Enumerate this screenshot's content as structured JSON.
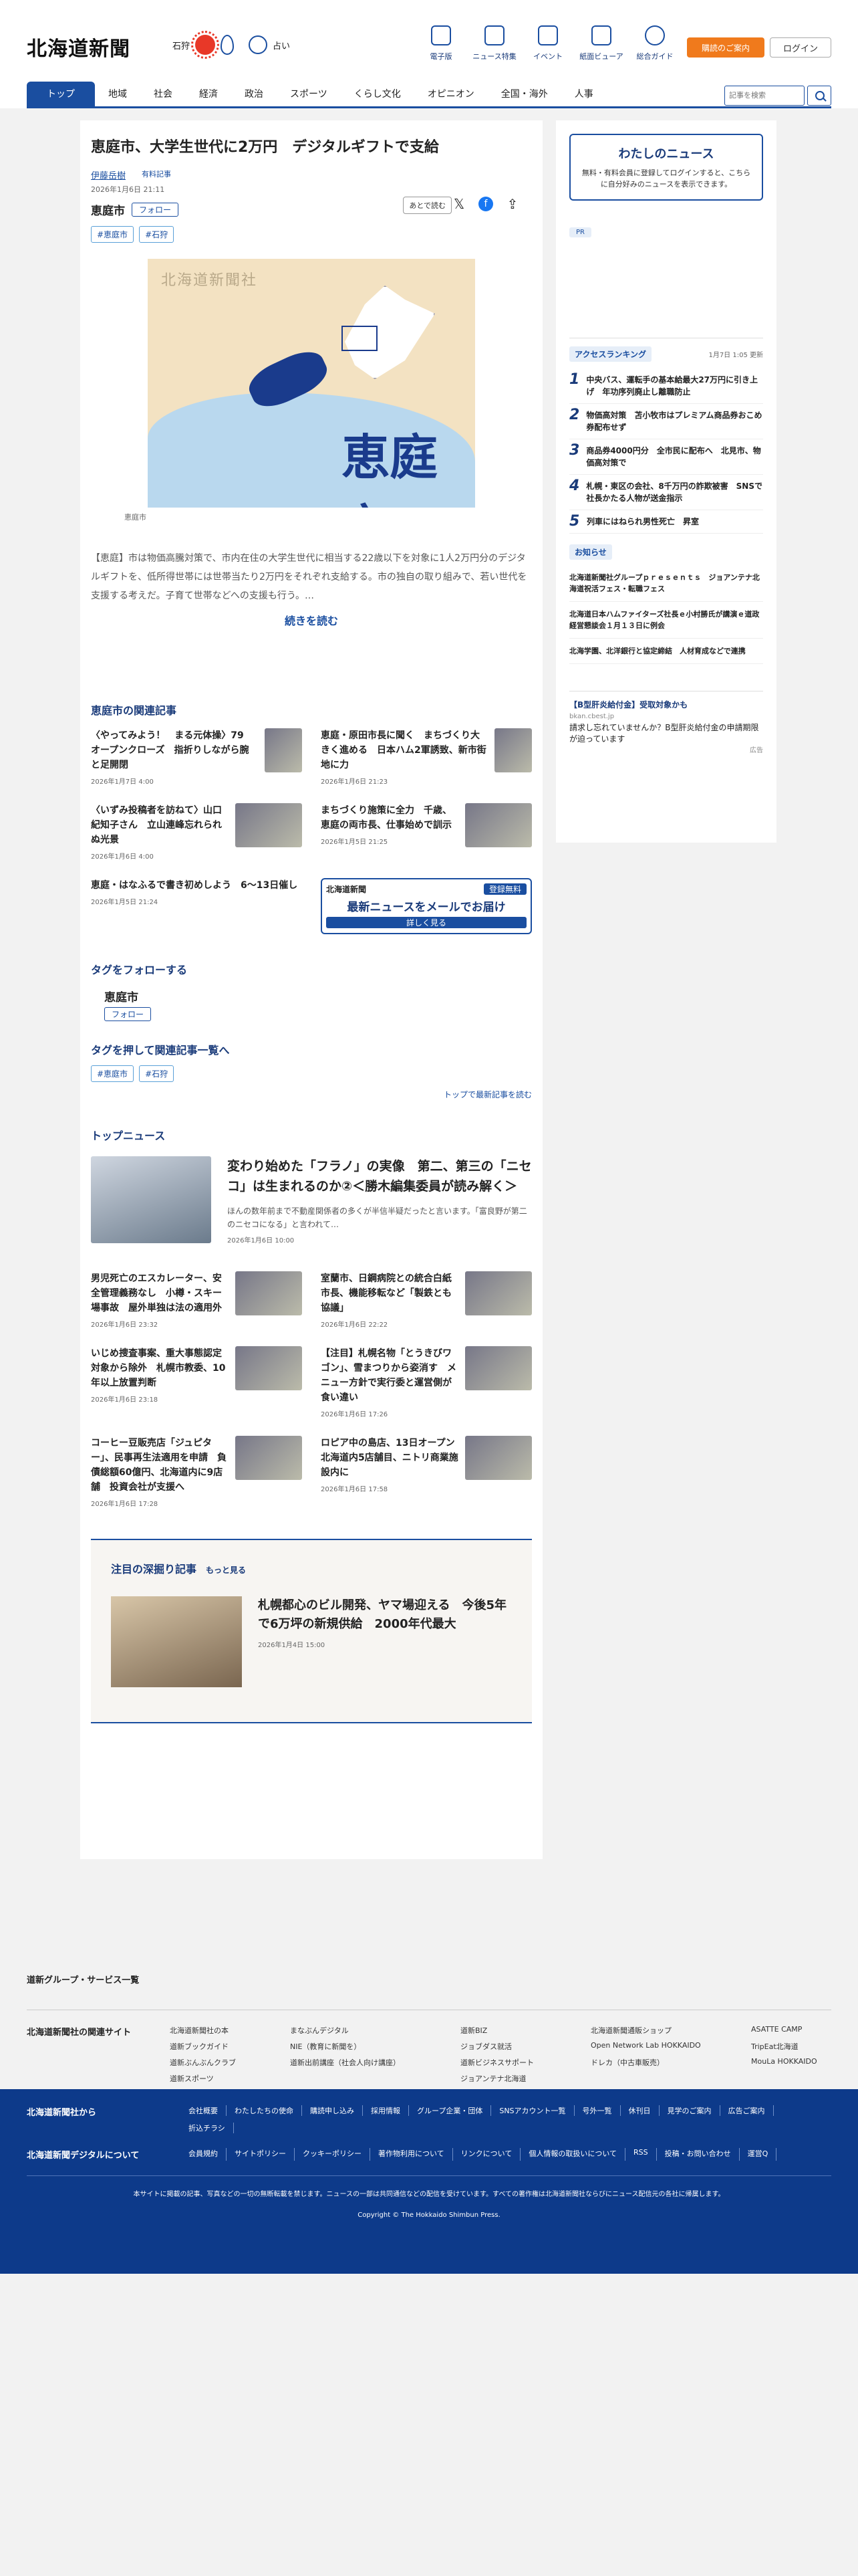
{
  "header": {
    "logo": "北海道新聞",
    "location": "石狩",
    "fortune_label": "占い",
    "nav": [
      "電子版",
      "ニュース特集",
      "イベント",
      "紙面ビューア",
      "総合ガイド"
    ],
    "subscribe": "購読のご案内",
    "login": "ログイン"
  },
  "mainnav": {
    "items": [
      "トップ",
      "地域",
      "社会",
      "経済",
      "政治",
      "スポーツ",
      "くらし文化",
      "オピニオン",
      "全国・海外",
      "人事"
    ],
    "search_placeholder": "記事を検索"
  },
  "article": {
    "title": "恵庭市、大学生世代に2万円　デジタルギフトで支給",
    "author": "伊藤岳樹",
    "subscriber_label": "有料記事",
    "date": "2026年1月6日 21:11",
    "later_button": "あとで読む",
    "category": "恵庭市",
    "follow": "フォロー",
    "tags": [
      "#恵庭市",
      "#石狩"
    ],
    "map_watermark": "北海道新聞社",
    "map_city": "恵庭市",
    "caption": "恵庭市",
    "lead": "【恵庭】市は物価高騰対策で、市内在住の大学生世代に相当する22歳以下を対象に1人2万円分のデジタルギフトを、低所得世帯には世帯当たり2万円をそれぞれ支給する。市の独自の取り組みで、若い世代を支援する考えだ。子育て世帯などへの支援も行う。…",
    "read_more": "続きを読む"
  },
  "related": {
    "heading": "恵庭市の関連記事",
    "items": [
      {
        "title": "〈やってみよう！　まる元体操〉79　オープンクローズ　指折りしながら腕と足開閉",
        "date": "2026年1月7日 4:00"
      },
      {
        "title": "恵庭・原田市長に聞く　まちづくり大きく進める　日本ハム2軍誘致、新市街地に力",
        "date": "2026年1月6日 21:23"
      },
      {
        "title": "〈いずみ投稿者を訪ねて〉山口紀知子さん　立山連峰忘れられぬ光景",
        "date": "2026年1月6日 4:00"
      },
      {
        "title": "まちづくり施策に全力　千歳、恵庭の両市長、仕事始めで訓示",
        "date": "2026年1月5日 21:25"
      },
      {
        "title": "恵庭・はなふるで書き初めしよう　6～13日催し",
        "date": "2026年1月5日 21:24"
      }
    ],
    "ad": {
      "brand": "北海道新聞",
      "free": "登録無料",
      "headline": "最新ニュースをメールでお届け",
      "detail": "詳しく見る"
    }
  },
  "tagfollow": {
    "heading": "タグをフォローする",
    "name": "恵庭市",
    "follow": "フォロー"
  },
  "taglist": {
    "heading": "タグを押して関連記事一覧へ",
    "tags": [
      "#恵庭市",
      "#石狩"
    ],
    "latest": "トップで最新記事を読む"
  },
  "topnews": {
    "heading": "トップニュース",
    "feature": {
      "title": "変わり始めた「フラノ」の実像　第二、第三の「ニセコ」は生まれるのか②＜勝木編集委員が読み解く＞",
      "desc": "ほんの数年前まで不動産関係者の多くが半信半疑だったと言います。「富良野が第二のニセコになる」と言われて…",
      "date": "2026年1月6日 10:00"
    },
    "items": [
      {
        "title": "男児死亡のエスカレーター、安全管理義務なし　小樽・スキー場事故　屋外単独は法の適用外",
        "date": "2026年1月6日 23:32"
      },
      {
        "title": "室蘭市、日鋼病院との統合白紙　市長、機能移転など「製鉄とも協議」",
        "date": "2026年1月6日 22:22"
      },
      {
        "title": "いじめ捜査事案、重大事態認定対象から除外　札幌市教委、10年以上放置判断",
        "date": "2026年1月6日 23:18"
      },
      {
        "title": "【注目】札幌名物「とうきびワゴン」、雪まつりから姿消す　メニュー方針で実行委と運営側が食い違い",
        "date": "2026年1月6日 17:26"
      },
      {
        "title": "コーヒー豆販売店「ジュピター」、民事再生法適用を申請　負債総額60億円、北海道内に9店舗　投資会社が支援へ",
        "date": "2026年1月6日 17:28"
      },
      {
        "title": "ロピア中の島店、13日オープン　北海道内5店舗目、ニトリ商業施設内に",
        "date": "2026年1月6日 17:58"
      }
    ]
  },
  "deep": {
    "heading": "注目の深掘り記事",
    "more": "もっと見る",
    "title": "札幌都心のビル開発、ヤマ場迎える　今後5年で6万坪の新規供給　2000年代最大",
    "date": "2026年1月4日 15:00"
  },
  "side": {
    "mynews_title": "わたしのニュース",
    "mynews_text": "無料・有料会員に登録してログインすると、こちらに自分好みのニュースを表示できます。",
    "pr": "PR",
    "ranking_heading": "アクセスランキング",
    "ranking_updated": "1月7日 1:05 更新",
    "ranking": [
      "中央バス、運転手の基本給最大27万円に引き上げ　年功序列廃止し離職防止",
      "物価高対策　苫小牧市はプレミアム商品券おこめ券配布せず",
      "商品券4000円分　全市民に配布へ　北見市、物価高対策で",
      "札幌・東区の会社、8千万円の詐欺被害　SNSで社長かたる人物が送金指示",
      "列車にはねられ男性死亡　昇室"
    ],
    "notice_heading": "お知らせ",
    "notices": [
      "北海道新聞社グループｐｒｅｓｅｎｔｓ　ジョアンテナ北海道祝活フェス・転職フェス",
      "北海道日本ハムファイターズ社長ｅ小村勝氏が講演ｅ道政経営懇談会１月１３日に例会",
      "北海学園、北洋銀行と協定締結　人材育成などで連携"
    ],
    "ad_title": "【B型肝炎給付金】受取対象かも",
    "ad_url": "bkan.cbest.jp",
    "ad_text": "請求し忘れていませんか？B型肝炎給付金の申請期限が迫っています",
    "ad_label": "広告"
  },
  "footer": {
    "group": "道新グループ・サービス一覧",
    "related_label": "北海道新聞社の関連サイト",
    "related": [
      "北海道新聞社の本",
      "まなぶんデジタル",
      "道新BIZ",
      "北海道新聞通販ショップ",
      "ASATTE CAMP",
      "道新ブックガイド",
      "NIE（教育に新聞を）",
      "ジョブダス就活",
      "Open Network Lab HOKKAIDO",
      "TripEat北海道",
      "道新ぶんぶんクラブ",
      "道新出前講座（社会人向け講座）",
      "道新ビジネスサポート",
      "ドレカ（中古車販売）",
      "MouLa HOKKAIDO",
      "道新スポーツ",
      "",
      "ジョアンテナ北海道",
      "",
      ""
    ],
    "company_label": "北海道新聞社から",
    "company": [
      "会社概要",
      "わたしたちの使命",
      "購読申し込み",
      "採用情報",
      "グループ企業・団体",
      "SNSアカウント一覧",
      "号外一覧",
      "休刊日",
      "見学のご案内",
      "広告ご案内",
      "折込チラシ"
    ],
    "digital_label": "北海道新聞デジタルについて",
    "digital": [
      "会員規約",
      "サイトポリシー",
      "クッキーポリシー",
      "著作物利用について",
      "リンクについて",
      "個人情報の取扱いについて",
      "RSS",
      "投稿・お問い合わせ",
      "運営Q"
    ],
    "note": "本サイトに掲載の記事、写真などの一切の無断転載を禁じます。ニュースの一部は共同通信などの配信を受けています。すべての著作権は北海道新聞社ならびにニュース配信元の各社に帰属します。",
    "copyright": "Copyright © The Hokkaido Shimbun Press."
  },
  "colors": {
    "brand": "#1a4ea0",
    "accent": "#f07a1c",
    "footer": "#0d3a8a"
  }
}
